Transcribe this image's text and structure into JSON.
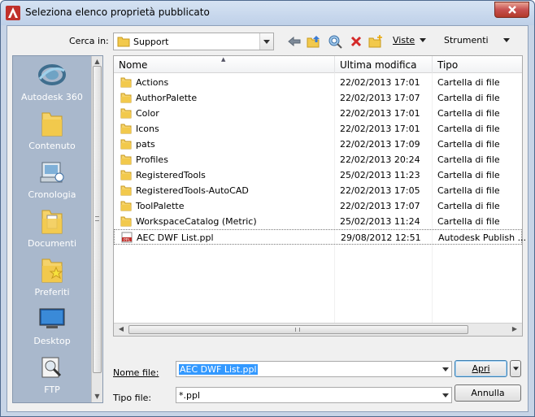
{
  "window": {
    "title": "Seleziona elenco proprietà pubblicato"
  },
  "toolbar": {
    "lookin_label": "Cerca in:",
    "lookin_value": "Support",
    "views_label": "Viste",
    "tools_label": "Strumenti"
  },
  "places": [
    {
      "label": "Autodesk 360",
      "icon": "autodesk-360-icon"
    },
    {
      "label": "Contenuto",
      "icon": "folder-icon"
    },
    {
      "label": "Cronologia",
      "icon": "history-icon"
    },
    {
      "label": "Documenti",
      "icon": "documents-icon"
    },
    {
      "label": "Preferiti",
      "icon": "favorites-icon"
    },
    {
      "label": "Desktop",
      "icon": "desktop-icon"
    },
    {
      "label": "FTP",
      "icon": "ftp-icon"
    }
  ],
  "columns": {
    "name": "Nome",
    "modified": "Ultima modifica",
    "type": "Tipo"
  },
  "files": [
    {
      "name": "Actions",
      "modified": "22/02/2013 17:01",
      "type": "Cartella di file",
      "kind": "folder"
    },
    {
      "name": "AuthorPalette",
      "modified": "22/02/2013 17:07",
      "type": "Cartella di file",
      "kind": "folder"
    },
    {
      "name": "Color",
      "modified": "22/02/2013 17:01",
      "type": "Cartella di file",
      "kind": "folder"
    },
    {
      "name": "Icons",
      "modified": "22/02/2013 17:01",
      "type": "Cartella di file",
      "kind": "folder"
    },
    {
      "name": "pats",
      "modified": "22/02/2013 17:09",
      "type": "Cartella di file",
      "kind": "folder"
    },
    {
      "name": "Profiles",
      "modified": "22/02/2013 20:24",
      "type": "Cartella di file",
      "kind": "folder"
    },
    {
      "name": "RegisteredTools",
      "modified": "25/02/2013 11:23",
      "type": "Cartella di file",
      "kind": "folder"
    },
    {
      "name": "RegisteredTools-AutoCAD",
      "modified": "22/02/2013 17:05",
      "type": "Cartella di file",
      "kind": "folder"
    },
    {
      "name": "ToolPalette",
      "modified": "22/02/2013 17:07",
      "type": "Cartella di file",
      "kind": "folder"
    },
    {
      "name": "WorkspaceCatalog (Metric)",
      "modified": "25/02/2013 11:24",
      "type": "Cartella di file",
      "kind": "folder"
    },
    {
      "name": "AEC DWF List.ppl",
      "modified": "29/08/2012 12:51",
      "type": "Autodesk Publish ...",
      "kind": "ppl"
    }
  ],
  "bottom": {
    "filename_label": "Nome file:",
    "filename_value": "AEC DWF List.ppl",
    "filetype_label": "Tipo file:",
    "filetype_value": "*.ppl",
    "open_label": "Apri",
    "cancel_label": "Annulla"
  },
  "colors": {
    "places_bg": "#a9b8cc",
    "selection": "#3399ff",
    "folder": "#f2c94c"
  }
}
